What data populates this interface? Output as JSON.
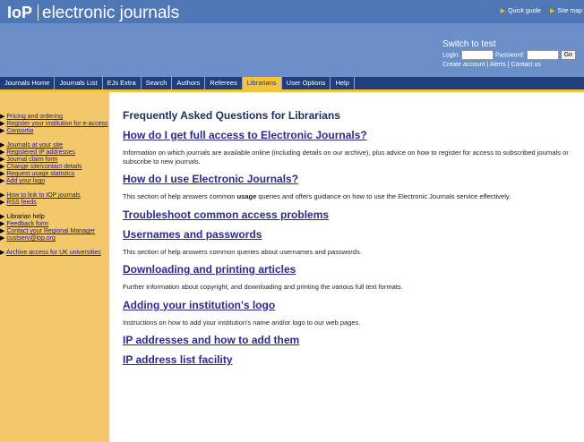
{
  "header": {
    "logo_mark": "IoP",
    "site_title": "electronic journals",
    "quick_guide": "Quick guide",
    "site_map": "Site map"
  },
  "login": {
    "switch_label": "Switch to test",
    "login_label": "Login:",
    "password_label": "Password:",
    "go_label": "Go",
    "create_account": "Create account",
    "alerts": "Alerts",
    "contact_us": "Contact us"
  },
  "nav": {
    "tabs": [
      "Journals Home",
      "Journals List",
      "EJs Extra",
      "Search",
      "Authors",
      "Referees",
      "Librarians",
      "User Options",
      "Help"
    ],
    "active": "Librarians"
  },
  "sidebar": {
    "groups": [
      [
        {
          "label": "Pricing and ordering",
          "link": true
        },
        {
          "label": "Register your institution for e-access",
          "link": true
        },
        {
          "label": "Consortia",
          "link": true
        }
      ],
      [
        {
          "label": "Journals at your site",
          "link": true
        },
        {
          "label": "Registered IP addresses",
          "link": true
        },
        {
          "label": "Journal claim form",
          "link": true
        },
        {
          "label": "Change site/contact details",
          "link": true
        },
        {
          "label": "Request usage statistics",
          "link": true
        },
        {
          "label": "Add your logo",
          "link": true
        }
      ],
      [
        {
          "label": "How to link to IOP journals",
          "link": true
        },
        {
          "label": "RSS feeds",
          "link": true
        }
      ],
      [
        {
          "label": "Librarian help",
          "link": false
        },
        {
          "label": "Feedback form",
          "link": true
        },
        {
          "label": "Contact your Regional Manager",
          "link": true
        },
        {
          "label": "custserv@iop.org",
          "link": true
        }
      ],
      [
        {
          "label": "Archive access for UK universities",
          "link": true
        }
      ]
    ]
  },
  "main": {
    "page_title": "Frequently Asked Questions for Librarians",
    "sections": [
      {
        "heading": "How do I get full access to Electronic Journals?",
        "text": "Information on which journals are available online (including details on our archive), plus advice on how to register for access to subscribed journals or subscribe to new journals."
      },
      {
        "heading": "How do I use Electronic Journals?",
        "text_before": "This section of help answers common ",
        "text_bold": "usage",
        "text_after": " queries and offers guidance on how to use the Electronic Journals service effectively."
      },
      {
        "heading": "Troubleshoot common access problems",
        "text": ""
      },
      {
        "heading": "Usernames and passwords",
        "text": "This section of help answers common queries about usernames and passwords."
      },
      {
        "heading": "Downloading and printing articles",
        "text": "Further information about copyright, and downloading and printing the various full text formats."
      },
      {
        "heading": "Adding your institution's logo",
        "text": "Instructions on how to add your institution's name and/or logo to our web pages."
      },
      {
        "heading": "IP addresses and how to add them",
        "text": ""
      },
      {
        "heading": "IP address list facility",
        "text": ""
      }
    ]
  },
  "colors": {
    "header_blue": "#6b8fc9",
    "nav_navy": "#1f3e7c",
    "accent_yellow": "#f3c33a",
    "sidebar_tan": "#f3c86b",
    "heading_link": "#2b2a8a"
  }
}
